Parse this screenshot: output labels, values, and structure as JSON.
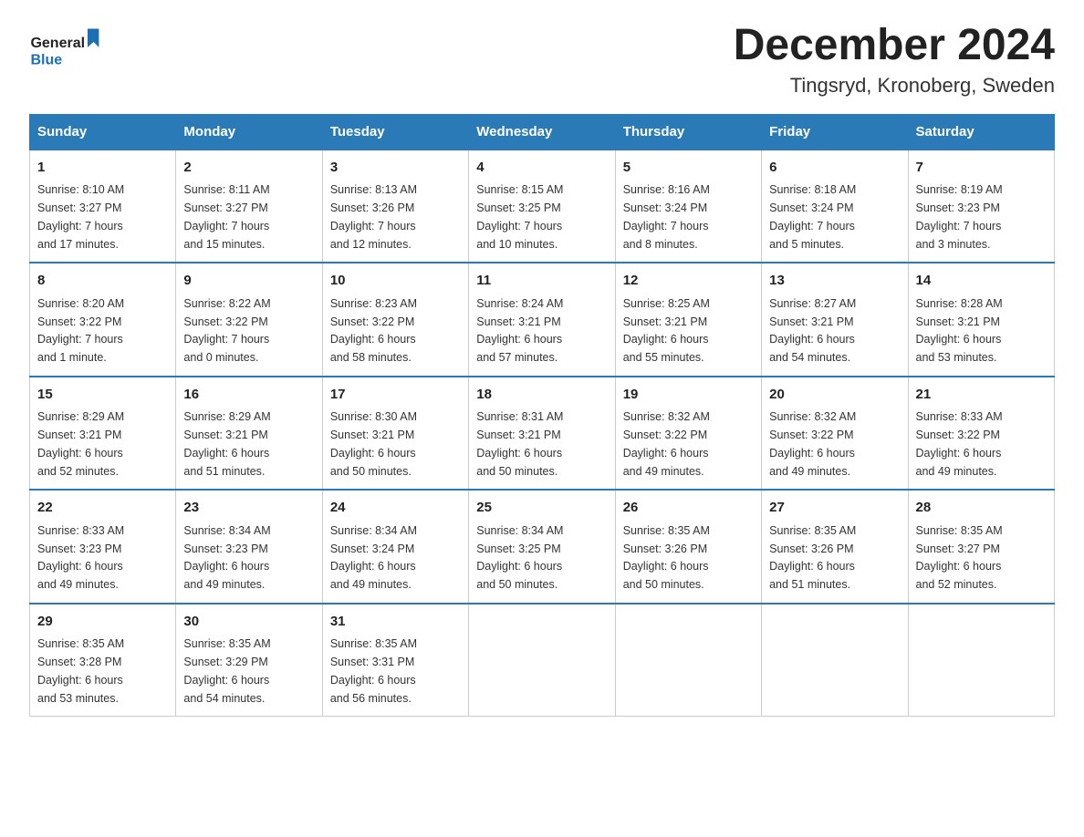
{
  "logo": {
    "general": "General",
    "blue": "Blue"
  },
  "title": "December 2024",
  "subtitle": "Tingsryd, Kronoberg, Sweden",
  "days_of_week": [
    "Sunday",
    "Monday",
    "Tuesday",
    "Wednesday",
    "Thursday",
    "Friday",
    "Saturday"
  ],
  "weeks": [
    [
      {
        "day": "1",
        "sunrise": "Sunrise: 8:10 AM",
        "sunset": "Sunset: 3:27 PM",
        "daylight": "Daylight: 7 hours",
        "daylight2": "and 17 minutes."
      },
      {
        "day": "2",
        "sunrise": "Sunrise: 8:11 AM",
        "sunset": "Sunset: 3:27 PM",
        "daylight": "Daylight: 7 hours",
        "daylight2": "and 15 minutes."
      },
      {
        "day": "3",
        "sunrise": "Sunrise: 8:13 AM",
        "sunset": "Sunset: 3:26 PM",
        "daylight": "Daylight: 7 hours",
        "daylight2": "and 12 minutes."
      },
      {
        "day": "4",
        "sunrise": "Sunrise: 8:15 AM",
        "sunset": "Sunset: 3:25 PM",
        "daylight": "Daylight: 7 hours",
        "daylight2": "and 10 minutes."
      },
      {
        "day": "5",
        "sunrise": "Sunrise: 8:16 AM",
        "sunset": "Sunset: 3:24 PM",
        "daylight": "Daylight: 7 hours",
        "daylight2": "and 8 minutes."
      },
      {
        "day": "6",
        "sunrise": "Sunrise: 8:18 AM",
        "sunset": "Sunset: 3:24 PM",
        "daylight": "Daylight: 7 hours",
        "daylight2": "and 5 minutes."
      },
      {
        "day": "7",
        "sunrise": "Sunrise: 8:19 AM",
        "sunset": "Sunset: 3:23 PM",
        "daylight": "Daylight: 7 hours",
        "daylight2": "and 3 minutes."
      }
    ],
    [
      {
        "day": "8",
        "sunrise": "Sunrise: 8:20 AM",
        "sunset": "Sunset: 3:22 PM",
        "daylight": "Daylight: 7 hours",
        "daylight2": "and 1 minute."
      },
      {
        "day": "9",
        "sunrise": "Sunrise: 8:22 AM",
        "sunset": "Sunset: 3:22 PM",
        "daylight": "Daylight: 7 hours",
        "daylight2": "and 0 minutes."
      },
      {
        "day": "10",
        "sunrise": "Sunrise: 8:23 AM",
        "sunset": "Sunset: 3:22 PM",
        "daylight": "Daylight: 6 hours",
        "daylight2": "and 58 minutes."
      },
      {
        "day": "11",
        "sunrise": "Sunrise: 8:24 AM",
        "sunset": "Sunset: 3:21 PM",
        "daylight": "Daylight: 6 hours",
        "daylight2": "and 57 minutes."
      },
      {
        "day": "12",
        "sunrise": "Sunrise: 8:25 AM",
        "sunset": "Sunset: 3:21 PM",
        "daylight": "Daylight: 6 hours",
        "daylight2": "and 55 minutes."
      },
      {
        "day": "13",
        "sunrise": "Sunrise: 8:27 AM",
        "sunset": "Sunset: 3:21 PM",
        "daylight": "Daylight: 6 hours",
        "daylight2": "and 54 minutes."
      },
      {
        "day": "14",
        "sunrise": "Sunrise: 8:28 AM",
        "sunset": "Sunset: 3:21 PM",
        "daylight": "Daylight: 6 hours",
        "daylight2": "and 53 minutes."
      }
    ],
    [
      {
        "day": "15",
        "sunrise": "Sunrise: 8:29 AM",
        "sunset": "Sunset: 3:21 PM",
        "daylight": "Daylight: 6 hours",
        "daylight2": "and 52 minutes."
      },
      {
        "day": "16",
        "sunrise": "Sunrise: 8:29 AM",
        "sunset": "Sunset: 3:21 PM",
        "daylight": "Daylight: 6 hours",
        "daylight2": "and 51 minutes."
      },
      {
        "day": "17",
        "sunrise": "Sunrise: 8:30 AM",
        "sunset": "Sunset: 3:21 PM",
        "daylight": "Daylight: 6 hours",
        "daylight2": "and 50 minutes."
      },
      {
        "day": "18",
        "sunrise": "Sunrise: 8:31 AM",
        "sunset": "Sunset: 3:21 PM",
        "daylight": "Daylight: 6 hours",
        "daylight2": "and 50 minutes."
      },
      {
        "day": "19",
        "sunrise": "Sunrise: 8:32 AM",
        "sunset": "Sunset: 3:22 PM",
        "daylight": "Daylight: 6 hours",
        "daylight2": "and 49 minutes."
      },
      {
        "day": "20",
        "sunrise": "Sunrise: 8:32 AM",
        "sunset": "Sunset: 3:22 PM",
        "daylight": "Daylight: 6 hours",
        "daylight2": "and 49 minutes."
      },
      {
        "day": "21",
        "sunrise": "Sunrise: 8:33 AM",
        "sunset": "Sunset: 3:22 PM",
        "daylight": "Daylight: 6 hours",
        "daylight2": "and 49 minutes."
      }
    ],
    [
      {
        "day": "22",
        "sunrise": "Sunrise: 8:33 AM",
        "sunset": "Sunset: 3:23 PM",
        "daylight": "Daylight: 6 hours",
        "daylight2": "and 49 minutes."
      },
      {
        "day": "23",
        "sunrise": "Sunrise: 8:34 AM",
        "sunset": "Sunset: 3:23 PM",
        "daylight": "Daylight: 6 hours",
        "daylight2": "and 49 minutes."
      },
      {
        "day": "24",
        "sunrise": "Sunrise: 8:34 AM",
        "sunset": "Sunset: 3:24 PM",
        "daylight": "Daylight: 6 hours",
        "daylight2": "and 49 minutes."
      },
      {
        "day": "25",
        "sunrise": "Sunrise: 8:34 AM",
        "sunset": "Sunset: 3:25 PM",
        "daylight": "Daylight: 6 hours",
        "daylight2": "and 50 minutes."
      },
      {
        "day": "26",
        "sunrise": "Sunrise: 8:35 AM",
        "sunset": "Sunset: 3:26 PM",
        "daylight": "Daylight: 6 hours",
        "daylight2": "and 50 minutes."
      },
      {
        "day": "27",
        "sunrise": "Sunrise: 8:35 AM",
        "sunset": "Sunset: 3:26 PM",
        "daylight": "Daylight: 6 hours",
        "daylight2": "and 51 minutes."
      },
      {
        "day": "28",
        "sunrise": "Sunrise: 8:35 AM",
        "sunset": "Sunset: 3:27 PM",
        "daylight": "Daylight: 6 hours",
        "daylight2": "and 52 minutes."
      }
    ],
    [
      {
        "day": "29",
        "sunrise": "Sunrise: 8:35 AM",
        "sunset": "Sunset: 3:28 PM",
        "daylight": "Daylight: 6 hours",
        "daylight2": "and 53 minutes."
      },
      {
        "day": "30",
        "sunrise": "Sunrise: 8:35 AM",
        "sunset": "Sunset: 3:29 PM",
        "daylight": "Daylight: 6 hours",
        "daylight2": "and 54 minutes."
      },
      {
        "day": "31",
        "sunrise": "Sunrise: 8:35 AM",
        "sunset": "Sunset: 3:31 PM",
        "daylight": "Daylight: 6 hours",
        "daylight2": "and 56 minutes."
      },
      null,
      null,
      null,
      null
    ]
  ]
}
